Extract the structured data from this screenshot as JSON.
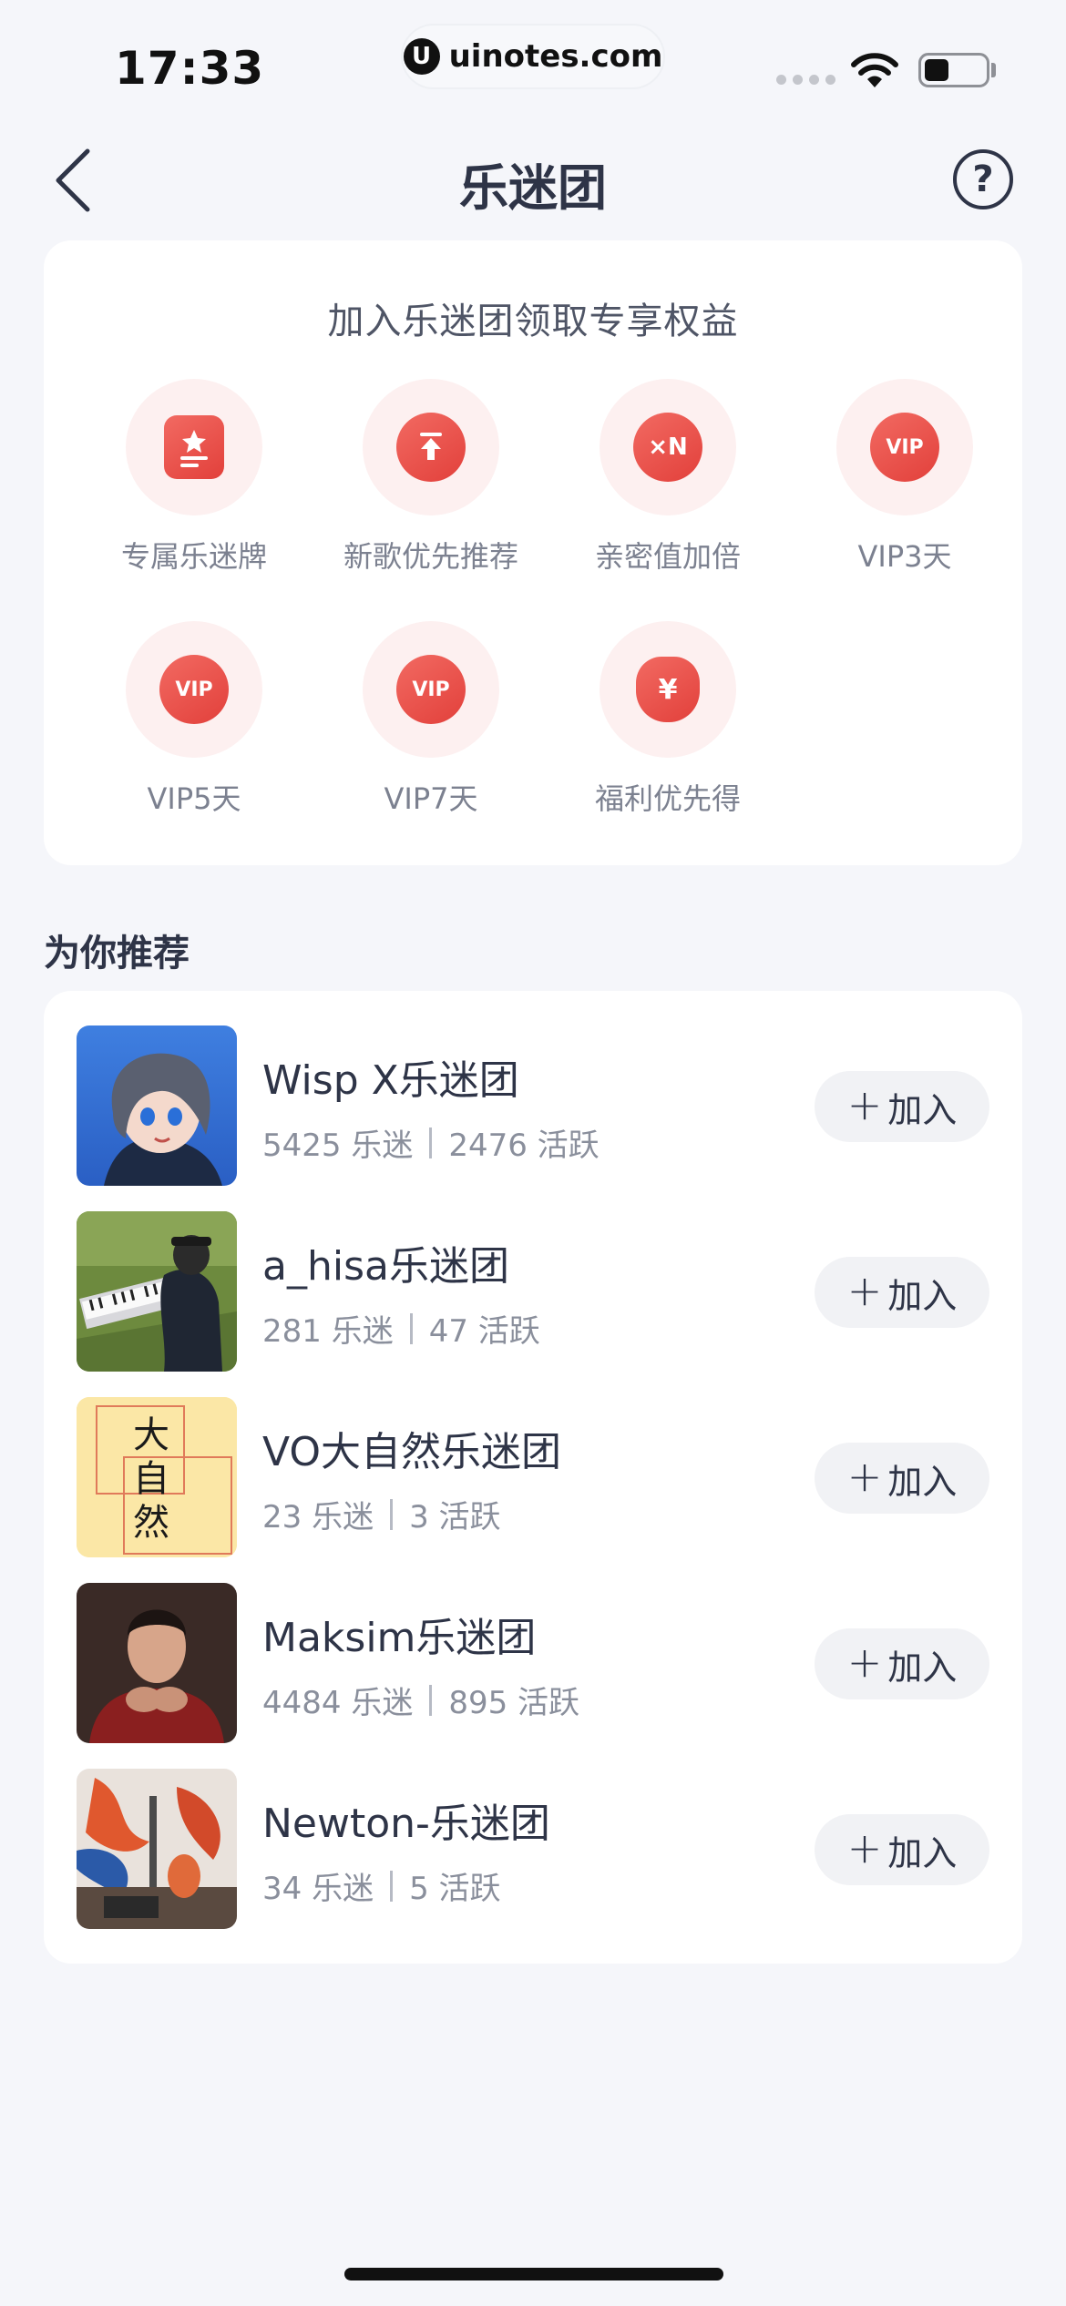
{
  "status_bar": {
    "time": "17:33",
    "url": "uinotes.com",
    "url_logo": "U"
  },
  "nav": {
    "title": "乐迷团",
    "help_symbol": "?"
  },
  "benefits": {
    "title": "加入乐迷团领取专享权益",
    "items": [
      {
        "label": "专属乐迷牌",
        "icon": "badge-card-icon"
      },
      {
        "label": "新歌优先推荐",
        "icon": "upload-arrow-icon"
      },
      {
        "label": "亲密值加倍",
        "icon": "multiply-n-icon",
        "glyph": "×N"
      },
      {
        "label": "VIP3天",
        "icon": "vip-icon",
        "glyph": "VIP"
      },
      {
        "label": "VIP5天",
        "icon": "vip-icon",
        "glyph": "VIP"
      },
      {
        "label": "VIP7天",
        "icon": "vip-icon",
        "glyph": "VIP"
      },
      {
        "label": "福利优先得",
        "icon": "money-bag-icon",
        "glyph": "¥"
      }
    ]
  },
  "recommend": {
    "title": "为你推荐",
    "join_label": "加入",
    "join_symbol": "+",
    "groups": [
      {
        "name": "Wisp X乐迷团",
        "fans": "5425 乐迷",
        "active": "2476 活跃"
      },
      {
        "name": "a_hisa乐迷团",
        "fans": "281 乐迷",
        "active": "47 活跃"
      },
      {
        "name": "VO大自然乐迷团",
        "fans": "23 乐迷",
        "active": "3 活跃",
        "avatar_text": [
          "大",
          "自",
          "然"
        ]
      },
      {
        "name": "Maksim乐迷团",
        "fans": "4484 乐迷",
        "active": "895 活跃"
      },
      {
        "name": "Newton-乐迷团",
        "fans": "34 乐迷",
        "active": "5 活跃"
      }
    ]
  },
  "colors": {
    "accent_red": "#e8453f",
    "badge_bg": "#fdf0f0",
    "page_bg": "#f5f6fa"
  }
}
